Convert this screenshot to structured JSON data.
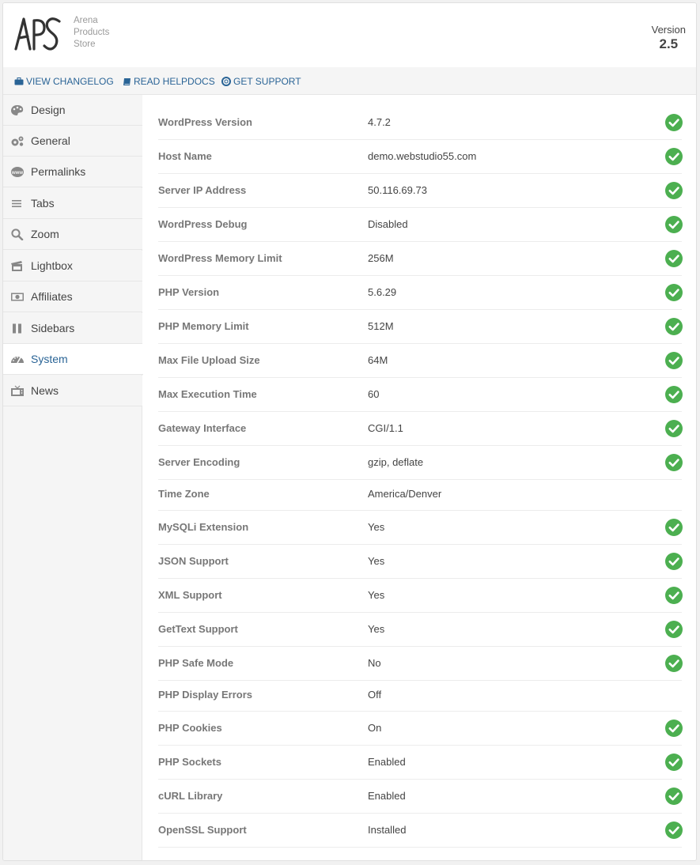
{
  "header": {
    "logo_lines": [
      "Arena",
      "Products",
      "Store"
    ],
    "version_label": "Version",
    "version_number": "2.5"
  },
  "toolbar": {
    "links": [
      {
        "label": "VIEW CHANGELOG",
        "icon": "briefcase-icon"
      },
      {
        "label": "READ HELPDOCS",
        "icon": "book-icon"
      },
      {
        "label": "GET SUPPORT",
        "icon": "lifebuoy-icon"
      }
    ]
  },
  "sidebar": {
    "active": "System",
    "items": [
      {
        "label": "Design",
        "icon": "palette-icon"
      },
      {
        "label": "General",
        "icon": "gears-icon"
      },
      {
        "label": "Permalinks",
        "icon": "www-icon"
      },
      {
        "label": "Tabs",
        "icon": "list-icon"
      },
      {
        "label": "Zoom",
        "icon": "magnifier-icon"
      },
      {
        "label": "Lightbox",
        "icon": "lightbox-icon"
      },
      {
        "label": "Affiliates",
        "icon": "money-icon"
      },
      {
        "label": "Sidebars",
        "icon": "columns-icon"
      },
      {
        "label": "System",
        "icon": "dashboard-icon"
      },
      {
        "label": "News",
        "icon": "tv-icon"
      }
    ]
  },
  "system_info": {
    "ok_color": "#4caf50",
    "rows": [
      {
        "label": "WordPress Version",
        "value": "4.7.2",
        "ok": true
      },
      {
        "label": "Host Name",
        "value": "demo.webstudio55.com",
        "ok": true
      },
      {
        "label": "Server IP Address",
        "value": "50.116.69.73",
        "ok": true
      },
      {
        "label": "WordPress Debug",
        "value": "Disabled",
        "ok": true
      },
      {
        "label": "WordPress Memory Limit",
        "value": "256M",
        "ok": true
      },
      {
        "label": "PHP Version",
        "value": "5.6.29",
        "ok": true
      },
      {
        "label": "PHP Memory Limit",
        "value": "512M",
        "ok": true
      },
      {
        "label": "Max File Upload Size",
        "value": "64M",
        "ok": true
      },
      {
        "label": "Max Execution Time",
        "value": "60",
        "ok": true
      },
      {
        "label": "Gateway Interface",
        "value": "CGI/1.1",
        "ok": true
      },
      {
        "label": "Server Encoding",
        "value": "gzip, deflate",
        "ok": true
      },
      {
        "label": "Time Zone",
        "value": "America/Denver",
        "ok": false
      },
      {
        "label": "MySQLi Extension",
        "value": "Yes",
        "ok": true
      },
      {
        "label": "JSON Support",
        "value": "Yes",
        "ok": true
      },
      {
        "label": "XML Support",
        "value": "Yes",
        "ok": true
      },
      {
        "label": "GetText Support",
        "value": "Yes",
        "ok": true
      },
      {
        "label": "PHP Safe Mode",
        "value": "No",
        "ok": true
      },
      {
        "label": "PHP Display Errors",
        "value": "Off",
        "ok": false
      },
      {
        "label": "PHP Cookies",
        "value": "On",
        "ok": true
      },
      {
        "label": "PHP Sockets",
        "value": "Enabled",
        "ok": true
      },
      {
        "label": "cURL Library",
        "value": "Enabled",
        "ok": true
      },
      {
        "label": "OpenSSL Support",
        "value": "Installed",
        "ok": true
      }
    ]
  }
}
